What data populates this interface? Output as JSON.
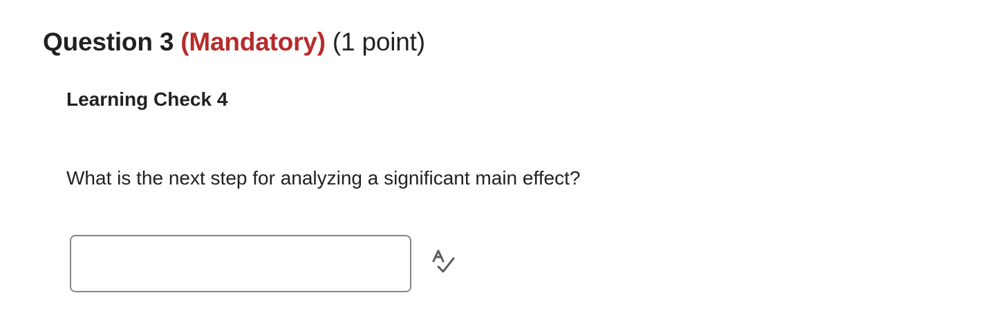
{
  "question": {
    "title": "Question 3",
    "mandatory": "(Mandatory)",
    "points": "(1 point)"
  },
  "section": {
    "title": "Learning Check 4"
  },
  "prompt": {
    "text": "What is the next step for analyzing a significant main effect?"
  },
  "answer": {
    "value": "",
    "placeholder": ""
  },
  "spellcheck": {
    "icon": "spellcheck-icon"
  },
  "colors": {
    "text": "#202122",
    "mandatory": "#b72b2b",
    "input_border": "#868686"
  }
}
